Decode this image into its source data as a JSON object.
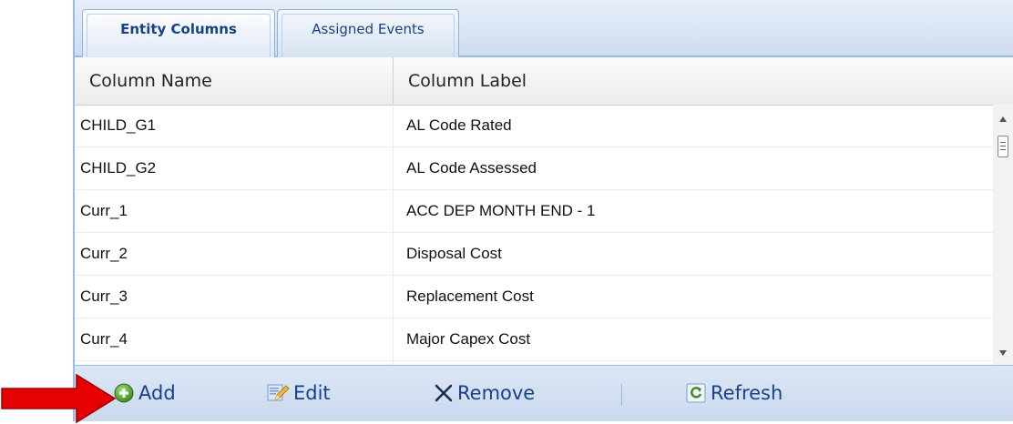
{
  "tabs": [
    {
      "label": "Entity Columns",
      "active": true
    },
    {
      "label": "Assigned Events",
      "active": false
    }
  ],
  "grid": {
    "columns": [
      "Column Name",
      "Column Label"
    ],
    "rows": [
      [
        "CHILD_G1",
        "AL Code Rated"
      ],
      [
        "CHILD_G2",
        "AL Code Assessed"
      ],
      [
        "Curr_1",
        "ACC DEP MONTH END - 1"
      ],
      [
        "Curr_2",
        "Disposal Cost"
      ],
      [
        "Curr_3",
        "Replacement Cost"
      ],
      [
        "Curr_4",
        "Major Capex Cost"
      ]
    ]
  },
  "toolbar": {
    "add_label": "Add",
    "edit_label": "Edit",
    "remove_label": "Remove",
    "refresh_label": "Refresh"
  },
  "icons": {
    "add": "add-circle-icon",
    "edit": "edit-pencil-icon",
    "remove": "x-icon",
    "refresh": "refresh-icon",
    "annotation": "red-arrow-icon"
  },
  "colors": {
    "accent": "#15428b",
    "panel_border": "#99bbe8",
    "annotation_arrow": "#e60000"
  }
}
